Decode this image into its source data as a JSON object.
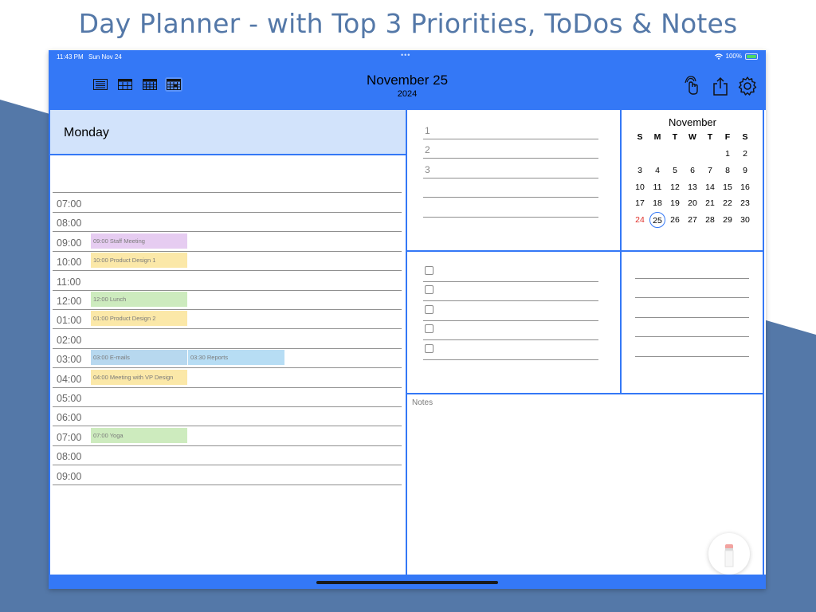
{
  "promo": {
    "title": "Day Planner - with Top 3 Priorities, ToDos & Notes"
  },
  "status_bar": {
    "time": "11:43 PM",
    "date": "Sun Nov 24",
    "battery": "100%"
  },
  "header": {
    "date": "November 25",
    "year": "2024",
    "view_buttons": [
      "day-list-icon",
      "week-grid-icon",
      "month-grid-icon",
      "day-planner-icon"
    ],
    "icons": [
      "hand-touch-icon",
      "share-icon",
      "gear-icon"
    ]
  },
  "day": {
    "label": "Monday"
  },
  "timeline": [
    {
      "time": "07:00",
      "events": []
    },
    {
      "time": "08:00",
      "events": []
    },
    {
      "time": "09:00",
      "events": [
        {
          "title": "09:00 Staff Meeting",
          "color": "#e6ccf1"
        }
      ]
    },
    {
      "time": "10:00",
      "events": [
        {
          "title": "10:00 Product Design 1",
          "color": "#fbe8a8"
        }
      ]
    },
    {
      "time": "11:00",
      "events": []
    },
    {
      "time": "12:00",
      "events": [
        {
          "title": "12:00 Lunch",
          "color": "#cdebbe"
        }
      ]
    },
    {
      "time": "01:00",
      "events": [
        {
          "title": "01:00 Product Design 2",
          "color": "#fbe8a8"
        }
      ]
    },
    {
      "time": "02:00",
      "events": []
    },
    {
      "time": "03:00",
      "events": [
        {
          "title": "03:00 E-mails",
          "color": "#b7d8ef"
        },
        {
          "title": "03:30 Reports",
          "color": "#b7ddf4"
        }
      ]
    },
    {
      "time": "04:00",
      "events": [
        {
          "title": "04:00 Meeting with VP Design",
          "color": "#fbe8a8"
        }
      ]
    },
    {
      "time": "05:00",
      "events": []
    },
    {
      "time": "06:00",
      "events": []
    },
    {
      "time": "07:00",
      "events": [
        {
          "title": "07:00 Yoga",
          "color": "#cdebbe"
        }
      ]
    },
    {
      "time": "08:00",
      "events": []
    },
    {
      "time": "09:00",
      "events": []
    }
  ],
  "priorities": [
    "1",
    "2",
    "3",
    "",
    ""
  ],
  "calendar": {
    "month": "November",
    "weekdays": [
      "S",
      "M",
      "T",
      "W",
      "T",
      "F",
      "S"
    ],
    "weeks": [
      [
        "",
        "",
        "",
        "",
        "",
        "1",
        "2"
      ],
      [
        "3",
        "4",
        "5",
        "6",
        "7",
        "8",
        "9"
      ],
      [
        "10",
        "11",
        "12",
        "13",
        "14",
        "15",
        "16"
      ],
      [
        "17",
        "18",
        "19",
        "20",
        "21",
        "22",
        "23"
      ],
      [
        "24",
        "25",
        "26",
        "27",
        "28",
        "29",
        "30"
      ]
    ],
    "selected_day": "25",
    "today_day": "24",
    "today_color": "#e0302a"
  },
  "todos": [
    "",
    "",
    "",
    "",
    ""
  ],
  "side_lines": [
    "",
    "",
    "",
    "",
    ""
  ],
  "notes": {
    "label": "Notes"
  },
  "colors": {
    "accent": "#3478f6",
    "day_banner": "#d2e3fb",
    "background_shape": "#5478a8"
  }
}
